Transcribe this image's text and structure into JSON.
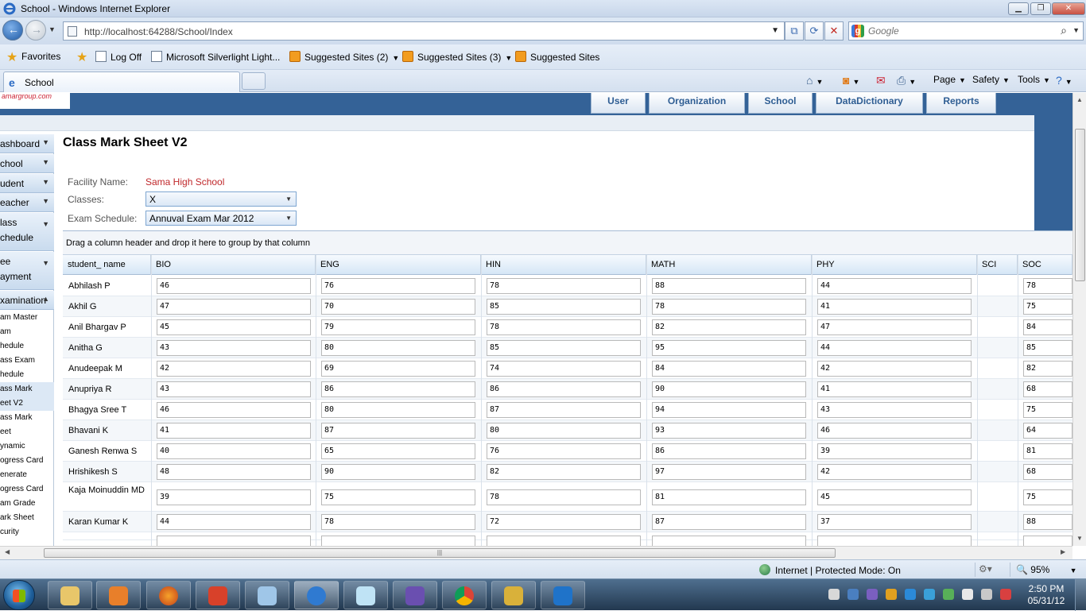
{
  "window": {
    "title": "School - Windows Internet Explorer"
  },
  "address": {
    "url": "http://localhost:64288/School/Index"
  },
  "search": {
    "placeholder": "Google"
  },
  "favorites": {
    "label": "Favorites",
    "items": [
      "Log Off",
      "Microsoft Silverlight Light...",
      "Suggested Sites (2)",
      "Suggested Sites (3)",
      "Suggested Sites"
    ]
  },
  "tabs": [
    {
      "label": "School"
    }
  ],
  "commandbar": {
    "page": "Page",
    "safety": "Safety",
    "tools": "Tools"
  },
  "topnav": [
    "User",
    "Organization",
    "School",
    "DataDictionary",
    "Reports"
  ],
  "sidebar": {
    "items": [
      "ashboard",
      "chool",
      "udent",
      "eacher",
      "lass",
      "chedule",
      "ee",
      "ayment",
      "xamination"
    ],
    "subitems": [
      "am Master",
      "am",
      "hedule",
      "ass Exam",
      "hedule",
      "ass Mark",
      "eet V2",
      "ass Mark",
      "eet",
      "ynamic",
      "ogress Card",
      "enerate",
      "ogress Card",
      "am Grade",
      "ark Sheet",
      "curity"
    ]
  },
  "main": {
    "title": "Class Mark Sheet V2",
    "facility_label": "Facility Name:",
    "facility_value": "Sama High School",
    "classes_label": "Classes:",
    "classes_value": "X",
    "exam_label": "Exam Schedule:",
    "exam_value": "Annuval Exam Mar 2012"
  },
  "grid": {
    "group_hint": "Drag a column header and drop it here to group by that column",
    "columns": [
      "student_ name",
      "BIO",
      "ENG",
      "HIN",
      "MATH",
      "PHY",
      "SCI",
      "SOC"
    ],
    "rows": [
      {
        "name": "Abhilash P",
        "BIO": "46",
        "ENG": "76",
        "HIN": "78",
        "MATH": "88",
        "PHY": "44",
        "SOC": "78"
      },
      {
        "name": "Akhil G",
        "BIO": "47",
        "ENG": "70",
        "HIN": "85",
        "MATH": "78",
        "PHY": "41",
        "SOC": "75"
      },
      {
        "name": "Anil Bhargav P",
        "BIO": "45",
        "ENG": "79",
        "HIN": "78",
        "MATH": "82",
        "PHY": "47",
        "SOC": "84"
      },
      {
        "name": "Anitha G",
        "BIO": "43",
        "ENG": "80",
        "HIN": "85",
        "MATH": "95",
        "PHY": "44",
        "SOC": "85"
      },
      {
        "name": "Anudeepak M",
        "BIO": "42",
        "ENG": "69",
        "HIN": "74",
        "MATH": "84",
        "PHY": "42",
        "SOC": "82"
      },
      {
        "name": "Anupriya R",
        "BIO": "43",
        "ENG": "86",
        "HIN": "86",
        "MATH": "90",
        "PHY": "41",
        "SOC": "68"
      },
      {
        "name": "Bhagya Sree T",
        "BIO": "46",
        "ENG": "80",
        "HIN": "87",
        "MATH": "94",
        "PHY": "43",
        "SOC": "75"
      },
      {
        "name": "Bhavani K",
        "BIO": "41",
        "ENG": "87",
        "HIN": "80",
        "MATH": "93",
        "PHY": "46",
        "SOC": "64"
      },
      {
        "name": "Ganesh Renwa S",
        "BIO": "40",
        "ENG": "65",
        "HIN": "76",
        "MATH": "86",
        "PHY": "39",
        "SOC": "81"
      },
      {
        "name": "Hrishikesh S",
        "BIO": "48",
        "ENG": "90",
        "HIN": "82",
        "MATH": "97",
        "PHY": "42",
        "SOC": "68"
      },
      {
        "name": "Kaja Moinuddin MD",
        "BIO": "39",
        "ENG": "75",
        "HIN": "78",
        "MATH": "81",
        "PHY": "45",
        "SOC": "75"
      },
      {
        "name": "Karan Kumar K",
        "BIO": "44",
        "ENG": "78",
        "HIN": "72",
        "MATH": "87",
        "PHY": "37",
        "SOC": "88"
      }
    ]
  },
  "status": {
    "zone": "Internet | Protected Mode: On",
    "zoom": "95%"
  },
  "clock": {
    "time": "2:50 PM",
    "date": "05/31/12"
  }
}
